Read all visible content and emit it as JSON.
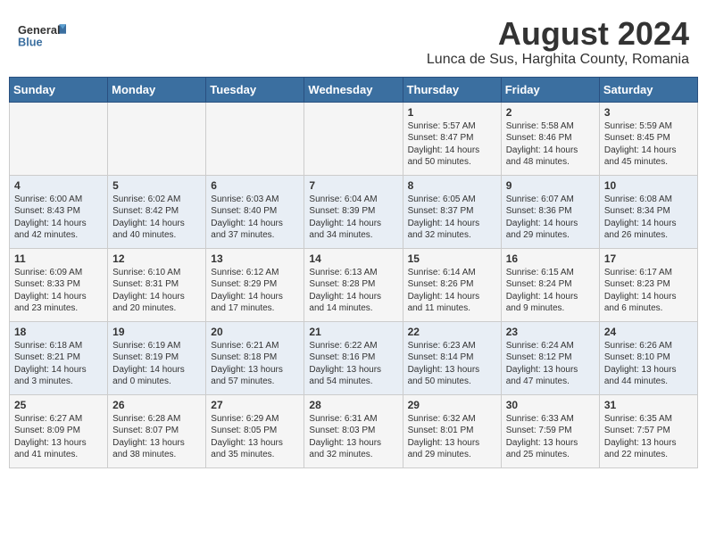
{
  "header": {
    "logo_general": "General",
    "logo_blue": "Blue",
    "title": "August 2024",
    "subtitle": "Lunca de Sus, Harghita County, Romania"
  },
  "weekdays": [
    "Sunday",
    "Monday",
    "Tuesday",
    "Wednesday",
    "Thursday",
    "Friday",
    "Saturday"
  ],
  "weeks": [
    [
      {
        "day": "",
        "info": ""
      },
      {
        "day": "",
        "info": ""
      },
      {
        "day": "",
        "info": ""
      },
      {
        "day": "",
        "info": ""
      },
      {
        "day": "1",
        "info": "Sunrise: 5:57 AM\nSunset: 8:47 PM\nDaylight: 14 hours\nand 50 minutes."
      },
      {
        "day": "2",
        "info": "Sunrise: 5:58 AM\nSunset: 8:46 PM\nDaylight: 14 hours\nand 48 minutes."
      },
      {
        "day": "3",
        "info": "Sunrise: 5:59 AM\nSunset: 8:45 PM\nDaylight: 14 hours\nand 45 minutes."
      }
    ],
    [
      {
        "day": "4",
        "info": "Sunrise: 6:00 AM\nSunset: 8:43 PM\nDaylight: 14 hours\nand 42 minutes."
      },
      {
        "day": "5",
        "info": "Sunrise: 6:02 AM\nSunset: 8:42 PM\nDaylight: 14 hours\nand 40 minutes."
      },
      {
        "day": "6",
        "info": "Sunrise: 6:03 AM\nSunset: 8:40 PM\nDaylight: 14 hours\nand 37 minutes."
      },
      {
        "day": "7",
        "info": "Sunrise: 6:04 AM\nSunset: 8:39 PM\nDaylight: 14 hours\nand 34 minutes."
      },
      {
        "day": "8",
        "info": "Sunrise: 6:05 AM\nSunset: 8:37 PM\nDaylight: 14 hours\nand 32 minutes."
      },
      {
        "day": "9",
        "info": "Sunrise: 6:07 AM\nSunset: 8:36 PM\nDaylight: 14 hours\nand 29 minutes."
      },
      {
        "day": "10",
        "info": "Sunrise: 6:08 AM\nSunset: 8:34 PM\nDaylight: 14 hours\nand 26 minutes."
      }
    ],
    [
      {
        "day": "11",
        "info": "Sunrise: 6:09 AM\nSunset: 8:33 PM\nDaylight: 14 hours\nand 23 minutes."
      },
      {
        "day": "12",
        "info": "Sunrise: 6:10 AM\nSunset: 8:31 PM\nDaylight: 14 hours\nand 20 minutes."
      },
      {
        "day": "13",
        "info": "Sunrise: 6:12 AM\nSunset: 8:29 PM\nDaylight: 14 hours\nand 17 minutes."
      },
      {
        "day": "14",
        "info": "Sunrise: 6:13 AM\nSunset: 8:28 PM\nDaylight: 14 hours\nand 14 minutes."
      },
      {
        "day": "15",
        "info": "Sunrise: 6:14 AM\nSunset: 8:26 PM\nDaylight: 14 hours\nand 11 minutes."
      },
      {
        "day": "16",
        "info": "Sunrise: 6:15 AM\nSunset: 8:24 PM\nDaylight: 14 hours\nand 9 minutes."
      },
      {
        "day": "17",
        "info": "Sunrise: 6:17 AM\nSunset: 8:23 PM\nDaylight: 14 hours\nand 6 minutes."
      }
    ],
    [
      {
        "day": "18",
        "info": "Sunrise: 6:18 AM\nSunset: 8:21 PM\nDaylight: 14 hours\nand 3 minutes."
      },
      {
        "day": "19",
        "info": "Sunrise: 6:19 AM\nSunset: 8:19 PM\nDaylight: 14 hours\nand 0 minutes."
      },
      {
        "day": "20",
        "info": "Sunrise: 6:21 AM\nSunset: 8:18 PM\nDaylight: 13 hours\nand 57 minutes."
      },
      {
        "day": "21",
        "info": "Sunrise: 6:22 AM\nSunset: 8:16 PM\nDaylight: 13 hours\nand 54 minutes."
      },
      {
        "day": "22",
        "info": "Sunrise: 6:23 AM\nSunset: 8:14 PM\nDaylight: 13 hours\nand 50 minutes."
      },
      {
        "day": "23",
        "info": "Sunrise: 6:24 AM\nSunset: 8:12 PM\nDaylight: 13 hours\nand 47 minutes."
      },
      {
        "day": "24",
        "info": "Sunrise: 6:26 AM\nSunset: 8:10 PM\nDaylight: 13 hours\nand 44 minutes."
      }
    ],
    [
      {
        "day": "25",
        "info": "Sunrise: 6:27 AM\nSunset: 8:09 PM\nDaylight: 13 hours\nand 41 minutes."
      },
      {
        "day": "26",
        "info": "Sunrise: 6:28 AM\nSunset: 8:07 PM\nDaylight: 13 hours\nand 38 minutes."
      },
      {
        "day": "27",
        "info": "Sunrise: 6:29 AM\nSunset: 8:05 PM\nDaylight: 13 hours\nand 35 minutes."
      },
      {
        "day": "28",
        "info": "Sunrise: 6:31 AM\nSunset: 8:03 PM\nDaylight: 13 hours\nand 32 minutes."
      },
      {
        "day": "29",
        "info": "Sunrise: 6:32 AM\nSunset: 8:01 PM\nDaylight: 13 hours\nand 29 minutes."
      },
      {
        "day": "30",
        "info": "Sunrise: 6:33 AM\nSunset: 7:59 PM\nDaylight: 13 hours\nand 25 minutes."
      },
      {
        "day": "31",
        "info": "Sunrise: 6:35 AM\nSunset: 7:57 PM\nDaylight: 13 hours\nand 22 minutes."
      }
    ]
  ]
}
